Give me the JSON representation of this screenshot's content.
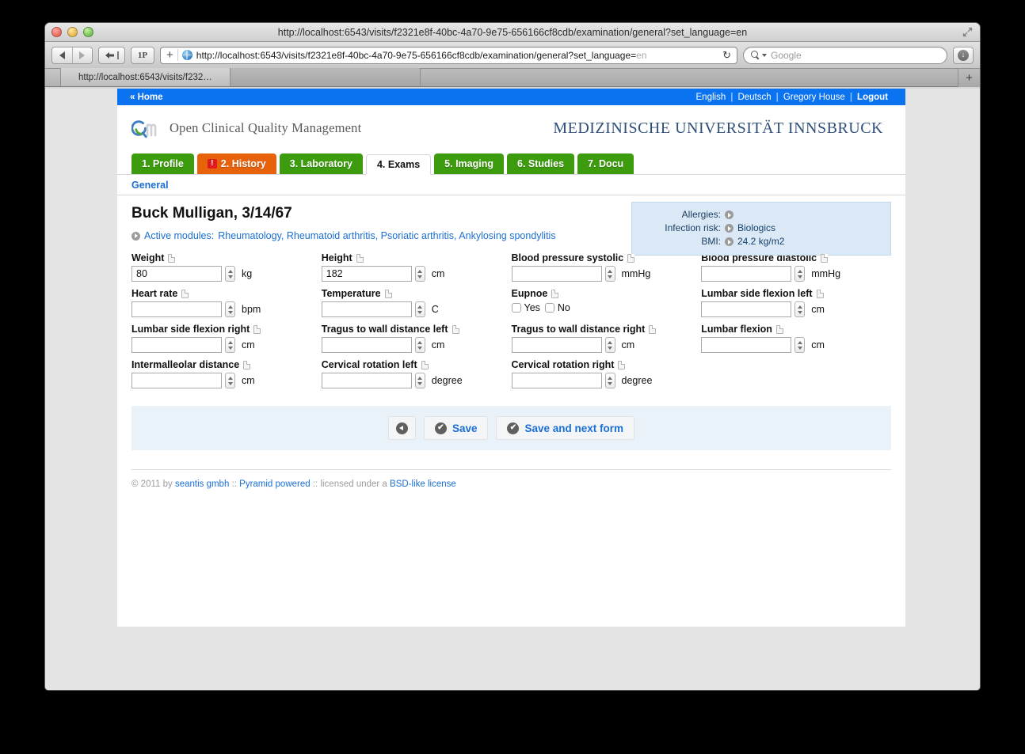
{
  "browser": {
    "window_title": "http://localhost:6543/visits/f2321e8f-40bc-4a70-9e75-656166cf8cdb/examination/general?set_language=en",
    "url_visible": "http://localhost:6543/visits/f2321e8f-40bc-4a70-9e75-656166cf8cdb/examination/general?set_language=",
    "url_faded": "en",
    "url_plus": "+",
    "reload_glyph": "↻",
    "onepassword_label": "1P",
    "search_placeholder": "Google",
    "tab_label": "http://localhost:6543/visits/f232…",
    "new_tab_label": "+",
    "downloads_glyph": "↓"
  },
  "topbar": {
    "home": "« Home",
    "links": [
      {
        "label": "English",
        "bold": false
      },
      {
        "label": "Deutsch",
        "bold": false
      },
      {
        "label": "Gregory House",
        "bold": false
      },
      {
        "label": "Logout",
        "bold": true
      }
    ],
    "separator": "|",
    "background": "#0b73f0"
  },
  "brand": {
    "name": "Open Clinical Quality Management",
    "university": "MEDIZINISCHE UNIVERSITÄT INNSBRUCK",
    "logo_colors": {
      "blue": "#3f7fc1",
      "green": "#5aa832",
      "gray": "#cfd1d3"
    }
  },
  "tabs": [
    {
      "label": "1. Profile",
      "state": "green",
      "badge": null
    },
    {
      "label": "2. History",
      "state": "orange",
      "badge": "!"
    },
    {
      "label": "3. Laboratory",
      "state": "green",
      "badge": null
    },
    {
      "label": "4. Exams",
      "state": "active",
      "badge": null
    },
    {
      "label": "5. Imaging",
      "state": "green",
      "badge": null
    },
    {
      "label": "6. Studies",
      "state": "green",
      "badge": null
    },
    {
      "label": "7. Docu",
      "state": "green",
      "badge": null
    }
  ],
  "subnav": {
    "general": "General"
  },
  "patient": {
    "name": "Buck Mulligan, 3/14/67",
    "modules_label": "Active modules:",
    "modules": "Rheumatology, Rheumatoid arthritis, Psoriatic arthritis, Ankylosing spondylitis"
  },
  "info_box": {
    "rows": [
      {
        "label": "Allergies:",
        "value": ""
      },
      {
        "label": "Infection risk:",
        "value": "Biologics"
      },
      {
        "label": "BMI:",
        "value": "24.2 kg/m2"
      }
    ],
    "background": "#dbe9f6"
  },
  "form": {
    "fields": [
      {
        "name": "weight",
        "label": "Weight",
        "type": "spin",
        "value": "80",
        "unit": "kg"
      },
      {
        "name": "height",
        "label": "Height",
        "type": "spin",
        "value": "182",
        "unit": "cm"
      },
      {
        "name": "blood-pressure-systolic",
        "label": "Blood pressure systolic",
        "type": "spin",
        "value": "",
        "unit": "mmHg"
      },
      {
        "name": "blood-pressure-diastolic",
        "label": "Blood pressure diastolic",
        "type": "spin",
        "value": "",
        "unit": "mmHg"
      },
      {
        "name": "heart-rate",
        "label": "Heart rate",
        "type": "spin",
        "value": "",
        "unit": "bpm"
      },
      {
        "name": "temperature",
        "label": "Temperature",
        "type": "spin",
        "value": "",
        "unit": "C"
      },
      {
        "name": "eupnoe",
        "label": "Eupnoe",
        "type": "radio",
        "options": [
          "Yes",
          "No"
        ]
      },
      {
        "name": "lumbar-side-flexion-left",
        "label": "Lumbar side flexion left",
        "type": "spin",
        "value": "",
        "unit": "cm"
      },
      {
        "name": "lumbar-side-flexion-right",
        "label": "Lumbar side flexion right",
        "type": "spin",
        "value": "",
        "unit": "cm"
      },
      {
        "name": "tragus-to-wall-left",
        "label": "Tragus to wall distance left",
        "type": "spin",
        "value": "",
        "unit": "cm"
      },
      {
        "name": "tragus-to-wall-right",
        "label": "Tragus to wall distance right",
        "type": "spin",
        "value": "",
        "unit": "cm"
      },
      {
        "name": "lumbar-flexion",
        "label": "Lumbar flexion",
        "type": "spin",
        "value": "",
        "unit": "cm"
      },
      {
        "name": "intermalleolar-distance",
        "label": "Intermalleolar distance",
        "type": "spin",
        "value": "",
        "unit": "cm"
      },
      {
        "name": "cervical-rotation-left",
        "label": "Cervical rotation left",
        "type": "spin",
        "value": "",
        "unit": "degree"
      },
      {
        "name": "cervical-rotation-right",
        "label": "Cervical rotation right",
        "type": "spin",
        "value": "",
        "unit": "degree"
      }
    ]
  },
  "actions": {
    "back_label": "",
    "save_label": "Save",
    "save_next_label": "Save and next form",
    "check_glyph": "✔"
  },
  "footer": {
    "copyright": "© 2011 by",
    "company": "seantis gmbh",
    "sep1": "::",
    "framework": "Pyramid powered",
    "sep2": "::",
    "license_pre": "licensed under a",
    "license": "BSD-like license"
  }
}
